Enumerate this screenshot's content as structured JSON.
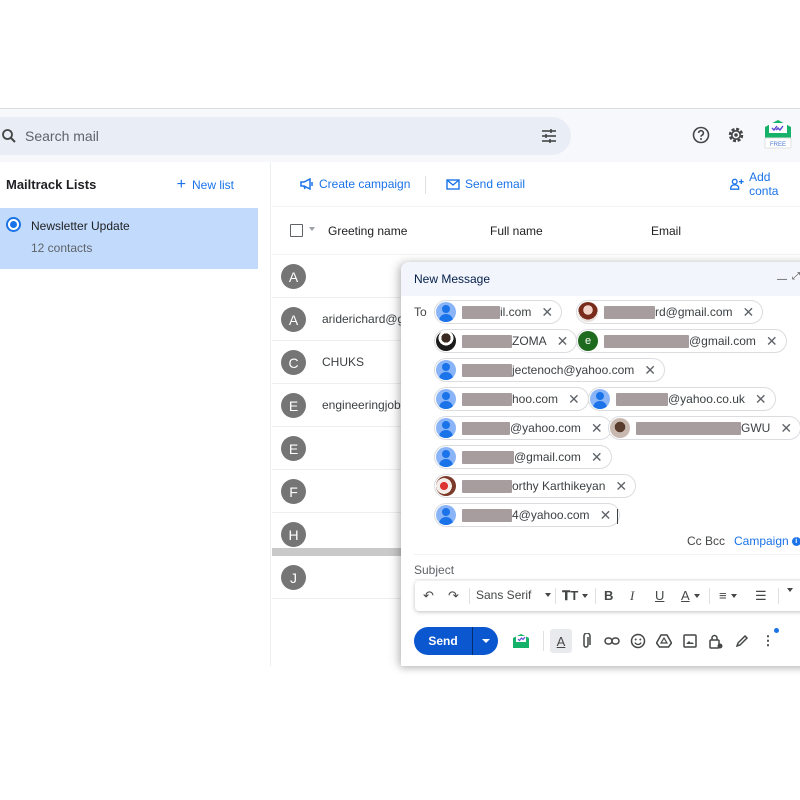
{
  "topbar": {
    "search_placeholder": "Search mail",
    "search_icon": "search-icon",
    "filter_icon": "tune-icon",
    "help_icon": "help-icon",
    "settings_icon": "gear-icon",
    "mailtrack_badge": "FREE"
  },
  "sidebar": {
    "title": "Mailtrack Lists",
    "new_list_label": "New list",
    "lists": [
      {
        "name": "Newsletter Update",
        "count": "12 contacts",
        "selected": true
      }
    ]
  },
  "main": {
    "actions": {
      "create_campaign": "Create campaign",
      "send_email": "Send email",
      "add_contact": "Add conta"
    },
    "columns": [
      "Greeting name",
      "Full name",
      "Email"
    ],
    "rows": [
      {
        "initial": "A",
        "greeting": ""
      },
      {
        "initial": "A",
        "greeting": "ariderichard@g"
      },
      {
        "initial": "C",
        "greeting": "CHUKS"
      },
      {
        "initial": "E",
        "greeting": "engineeringjobs"
      },
      {
        "initial": "E",
        "greeting": ""
      },
      {
        "initial": "F",
        "greeting": ""
      },
      {
        "initial": "H",
        "greeting": ""
      },
      {
        "initial": "J",
        "greeting": ""
      }
    ]
  },
  "compose": {
    "title": "New Message",
    "to_label": "To",
    "recipients": [
      {
        "visible_text": "il.com",
        "avatar": "default"
      },
      {
        "visible_text": "rd@gmail.com",
        "avatar": "photo"
      },
      {
        "visible_text": "ZOMA",
        "avatar": "photo"
      },
      {
        "visible_text": "@gmail.com",
        "avatar": "letter",
        "letter": "e"
      },
      {
        "visible_text": "jectenoch@yahoo.com",
        "avatar": "default"
      },
      {
        "visible_text": "hoo.com",
        "avatar": "default"
      },
      {
        "visible_text": "@yahoo.co.uk",
        "avatar": "default"
      },
      {
        "visible_text": "@yahoo.com",
        "avatar": "default"
      },
      {
        "visible_text": "GWU",
        "avatar": "photo"
      },
      {
        "visible_text": "@gmail.com",
        "avatar": "default"
      },
      {
        "visible_text": "orthy Karthikeyan",
        "avatar": "photo"
      },
      {
        "visible_text": "4@yahoo.com",
        "avatar": "default"
      }
    ],
    "cc_bcc": "Cc Bcc",
    "campaign": "Campaign",
    "subject_placeholder": "Subject",
    "font_family": "Sans Serif",
    "send_label": "Send",
    "accent": "#0b57d0"
  }
}
